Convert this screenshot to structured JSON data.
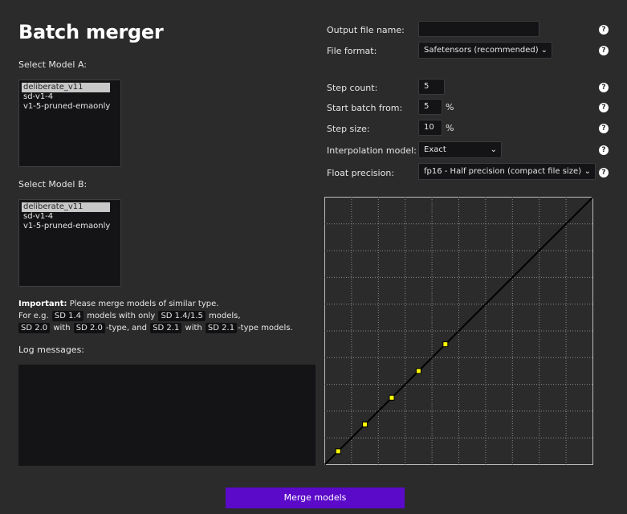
{
  "title": "Batch merger",
  "model_a": {
    "label": "Select Model A:",
    "options": [
      "deliberate_v11",
      "sd-v1-4",
      "v1-5-pruned-emaonly"
    ]
  },
  "model_b": {
    "label": "Select Model B:",
    "options": [
      "deliberate_v11",
      "sd-v1-4",
      "v1-5-pruned-emaonly"
    ]
  },
  "note": {
    "strong": "Important:",
    "line1": " Please merge models of similar type.",
    "l2_prefix": "For e.g.",
    "sd14": "SD 1.4",
    "l2_mid": "models with only",
    "sd1415": "SD 1.4/1.5",
    "l2_suffix": "models,",
    "sd20": "SD 2.0",
    "with": "with",
    "sd20b": "SD 2.0",
    "type_and": "-type, and",
    "sd21": "SD 2.1",
    "with2": "with",
    "sd21b": "SD 2.1",
    "type_models": "-type models."
  },
  "log": {
    "label": "Log messages:",
    "content": ""
  },
  "form": {
    "output_file_name": {
      "label": "Output file name:",
      "value": ""
    },
    "file_format": {
      "label": "File format:",
      "value": "Safetensors (recommended)"
    },
    "step_count": {
      "label": "Step count:",
      "value": "5"
    },
    "start_batch": {
      "label": "Start batch from:",
      "value": "5",
      "unit": "%"
    },
    "step_size": {
      "label": "Step size:",
      "value": "10",
      "unit": "%"
    },
    "interpolation": {
      "label": "Interpolation model:",
      "value": "Exact"
    },
    "float_precision": {
      "label": "Float precision:",
      "value": "fp16 - Half precision (compact file size)"
    },
    "help_glyph": "?"
  },
  "chart_data": {
    "type": "line",
    "xlim": [
      0,
      100
    ],
    "ylim": [
      0,
      100
    ],
    "grid": true,
    "grid_divisions": 10,
    "line": {
      "x": [
        0,
        100
      ],
      "y": [
        0,
        100
      ],
      "color": "#000000"
    },
    "points": {
      "x": [
        5,
        15,
        25,
        35,
        45
      ],
      "y": [
        5,
        15,
        25,
        35,
        45
      ],
      "color": "#ffff00"
    },
    "background": "#2b2b2c",
    "gridcolor": "#8a8a8a"
  },
  "merge_button": {
    "label": "Merge models",
    "color": "#5b0ac9"
  }
}
